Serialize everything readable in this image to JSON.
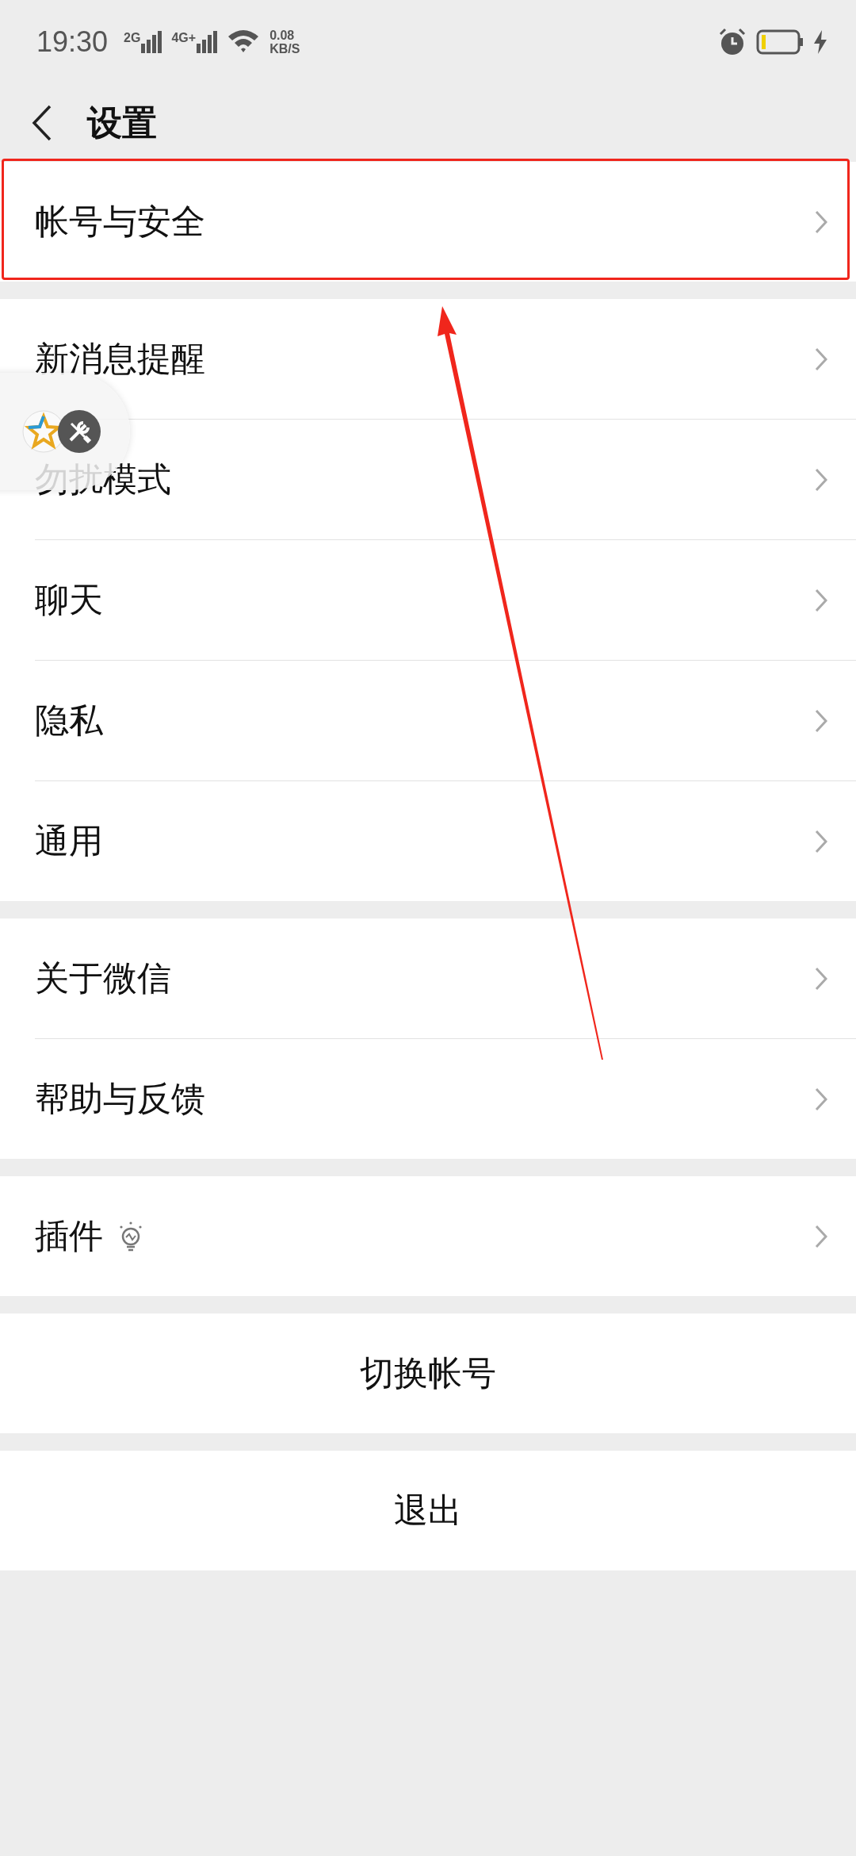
{
  "status_bar": {
    "time": "19:30",
    "sim1": "2G",
    "sim2": "4G+",
    "speed_value": "0.08",
    "speed_unit": "KB/S"
  },
  "header": {
    "title": "设置"
  },
  "groups": [
    {
      "items": [
        {
          "kind": "nav",
          "label": "帐号与安全",
          "highlighted": true,
          "bulb": false
        }
      ]
    },
    {
      "items": [
        {
          "kind": "nav",
          "label": "新消息提醒",
          "highlighted": false,
          "bulb": false
        },
        {
          "kind": "nav",
          "label": "勿扰模式",
          "highlighted": false,
          "bulb": false
        },
        {
          "kind": "nav",
          "label": "聊天",
          "highlighted": false,
          "bulb": false
        },
        {
          "kind": "nav",
          "label": "隐私",
          "highlighted": false,
          "bulb": false
        },
        {
          "kind": "nav",
          "label": "通用",
          "highlighted": false,
          "bulb": false
        }
      ]
    },
    {
      "items": [
        {
          "kind": "nav",
          "label": "关于微信",
          "highlighted": false,
          "bulb": false
        },
        {
          "kind": "nav",
          "label": "帮助与反馈",
          "highlighted": false,
          "bulb": false
        }
      ]
    },
    {
      "items": [
        {
          "kind": "nav",
          "label": "插件",
          "highlighted": false,
          "bulb": true
        }
      ]
    },
    {
      "items": [
        {
          "kind": "action",
          "label": "切换帐号",
          "highlighted": false,
          "bulb": false
        }
      ]
    },
    {
      "items": [
        {
          "kind": "action",
          "label": "退出",
          "highlighted": false,
          "bulb": false
        }
      ]
    }
  ]
}
